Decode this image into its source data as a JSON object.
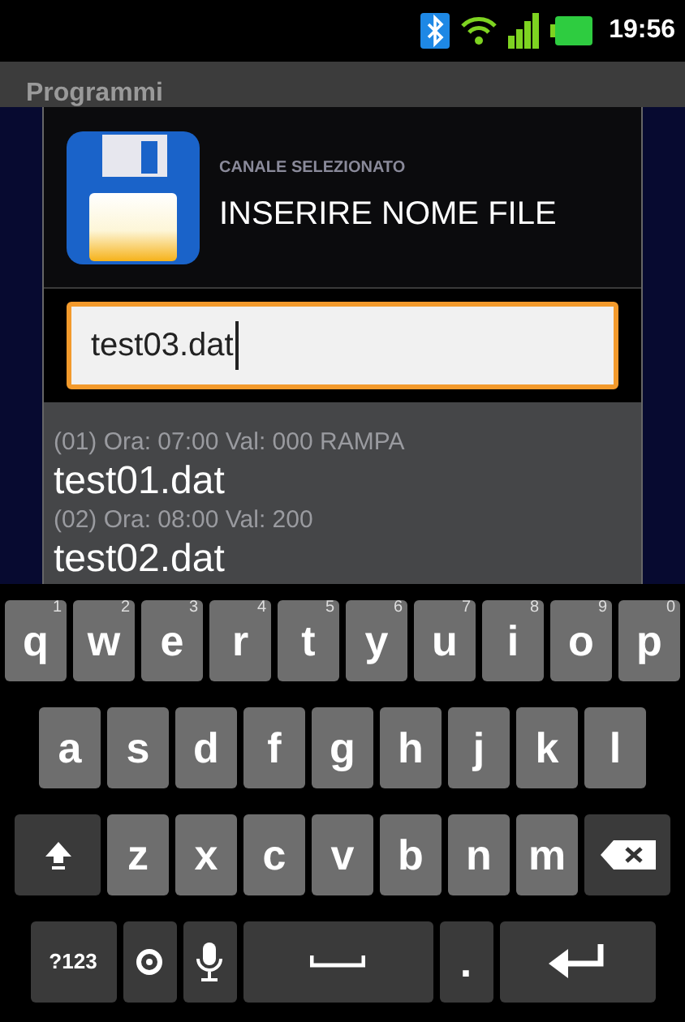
{
  "status_bar": {
    "time": "19:56"
  },
  "app_bar": {
    "title": "Programmi"
  },
  "dialog": {
    "title": "INSERIRE NOME FILE",
    "background_label": "CANALE SELEZIONATO",
    "input": {
      "value": "test03.dat"
    },
    "items": [
      {
        "kind": "ghost",
        "label": "(01) Ora: 07:00 Val: 000 RAMPA"
      },
      {
        "kind": "file",
        "label": "test01.dat"
      },
      {
        "kind": "ghost",
        "label": "(02) Ora: 08:00 Val: 200"
      },
      {
        "kind": "file",
        "label": "test02.dat"
      }
    ]
  },
  "keyboard": {
    "rows": [
      [
        {
          "kind": "letter",
          "label": "q",
          "hint": "1"
        },
        {
          "kind": "letter",
          "label": "w",
          "hint": "2"
        },
        {
          "kind": "letter",
          "label": "e",
          "hint": "3"
        },
        {
          "kind": "letter",
          "label": "r",
          "hint": "4"
        },
        {
          "kind": "letter",
          "label": "t",
          "hint": "5"
        },
        {
          "kind": "letter",
          "label": "y",
          "hint": "6"
        },
        {
          "kind": "letter",
          "label": "u",
          "hint": "7"
        },
        {
          "kind": "letter",
          "label": "i",
          "hint": "8"
        },
        {
          "kind": "letter",
          "label": "o",
          "hint": "9"
        },
        {
          "kind": "letter",
          "label": "p",
          "hint": "0"
        }
      ],
      [
        {
          "kind": "letter",
          "label": "a"
        },
        {
          "kind": "letter",
          "label": "s"
        },
        {
          "kind": "letter",
          "label": "d"
        },
        {
          "kind": "letter",
          "label": "f"
        },
        {
          "kind": "letter",
          "label": "g"
        },
        {
          "kind": "letter",
          "label": "h"
        },
        {
          "kind": "letter",
          "label": "j"
        },
        {
          "kind": "letter",
          "label": "k"
        },
        {
          "kind": "letter",
          "label": "l"
        }
      ],
      [
        {
          "kind": "shift"
        },
        {
          "kind": "letter",
          "label": "z"
        },
        {
          "kind": "letter",
          "label": "x"
        },
        {
          "kind": "letter",
          "label": "c"
        },
        {
          "kind": "letter",
          "label": "v"
        },
        {
          "kind": "letter",
          "label": "b"
        },
        {
          "kind": "letter",
          "label": "n"
        },
        {
          "kind": "letter",
          "label": "m"
        },
        {
          "kind": "backspace"
        }
      ],
      [
        {
          "kind": "symbols",
          "label": "?123"
        },
        {
          "kind": "settings"
        },
        {
          "kind": "mic"
        },
        {
          "kind": "space"
        },
        {
          "kind": "period",
          "label": "."
        },
        {
          "kind": "enter"
        }
      ]
    ]
  }
}
